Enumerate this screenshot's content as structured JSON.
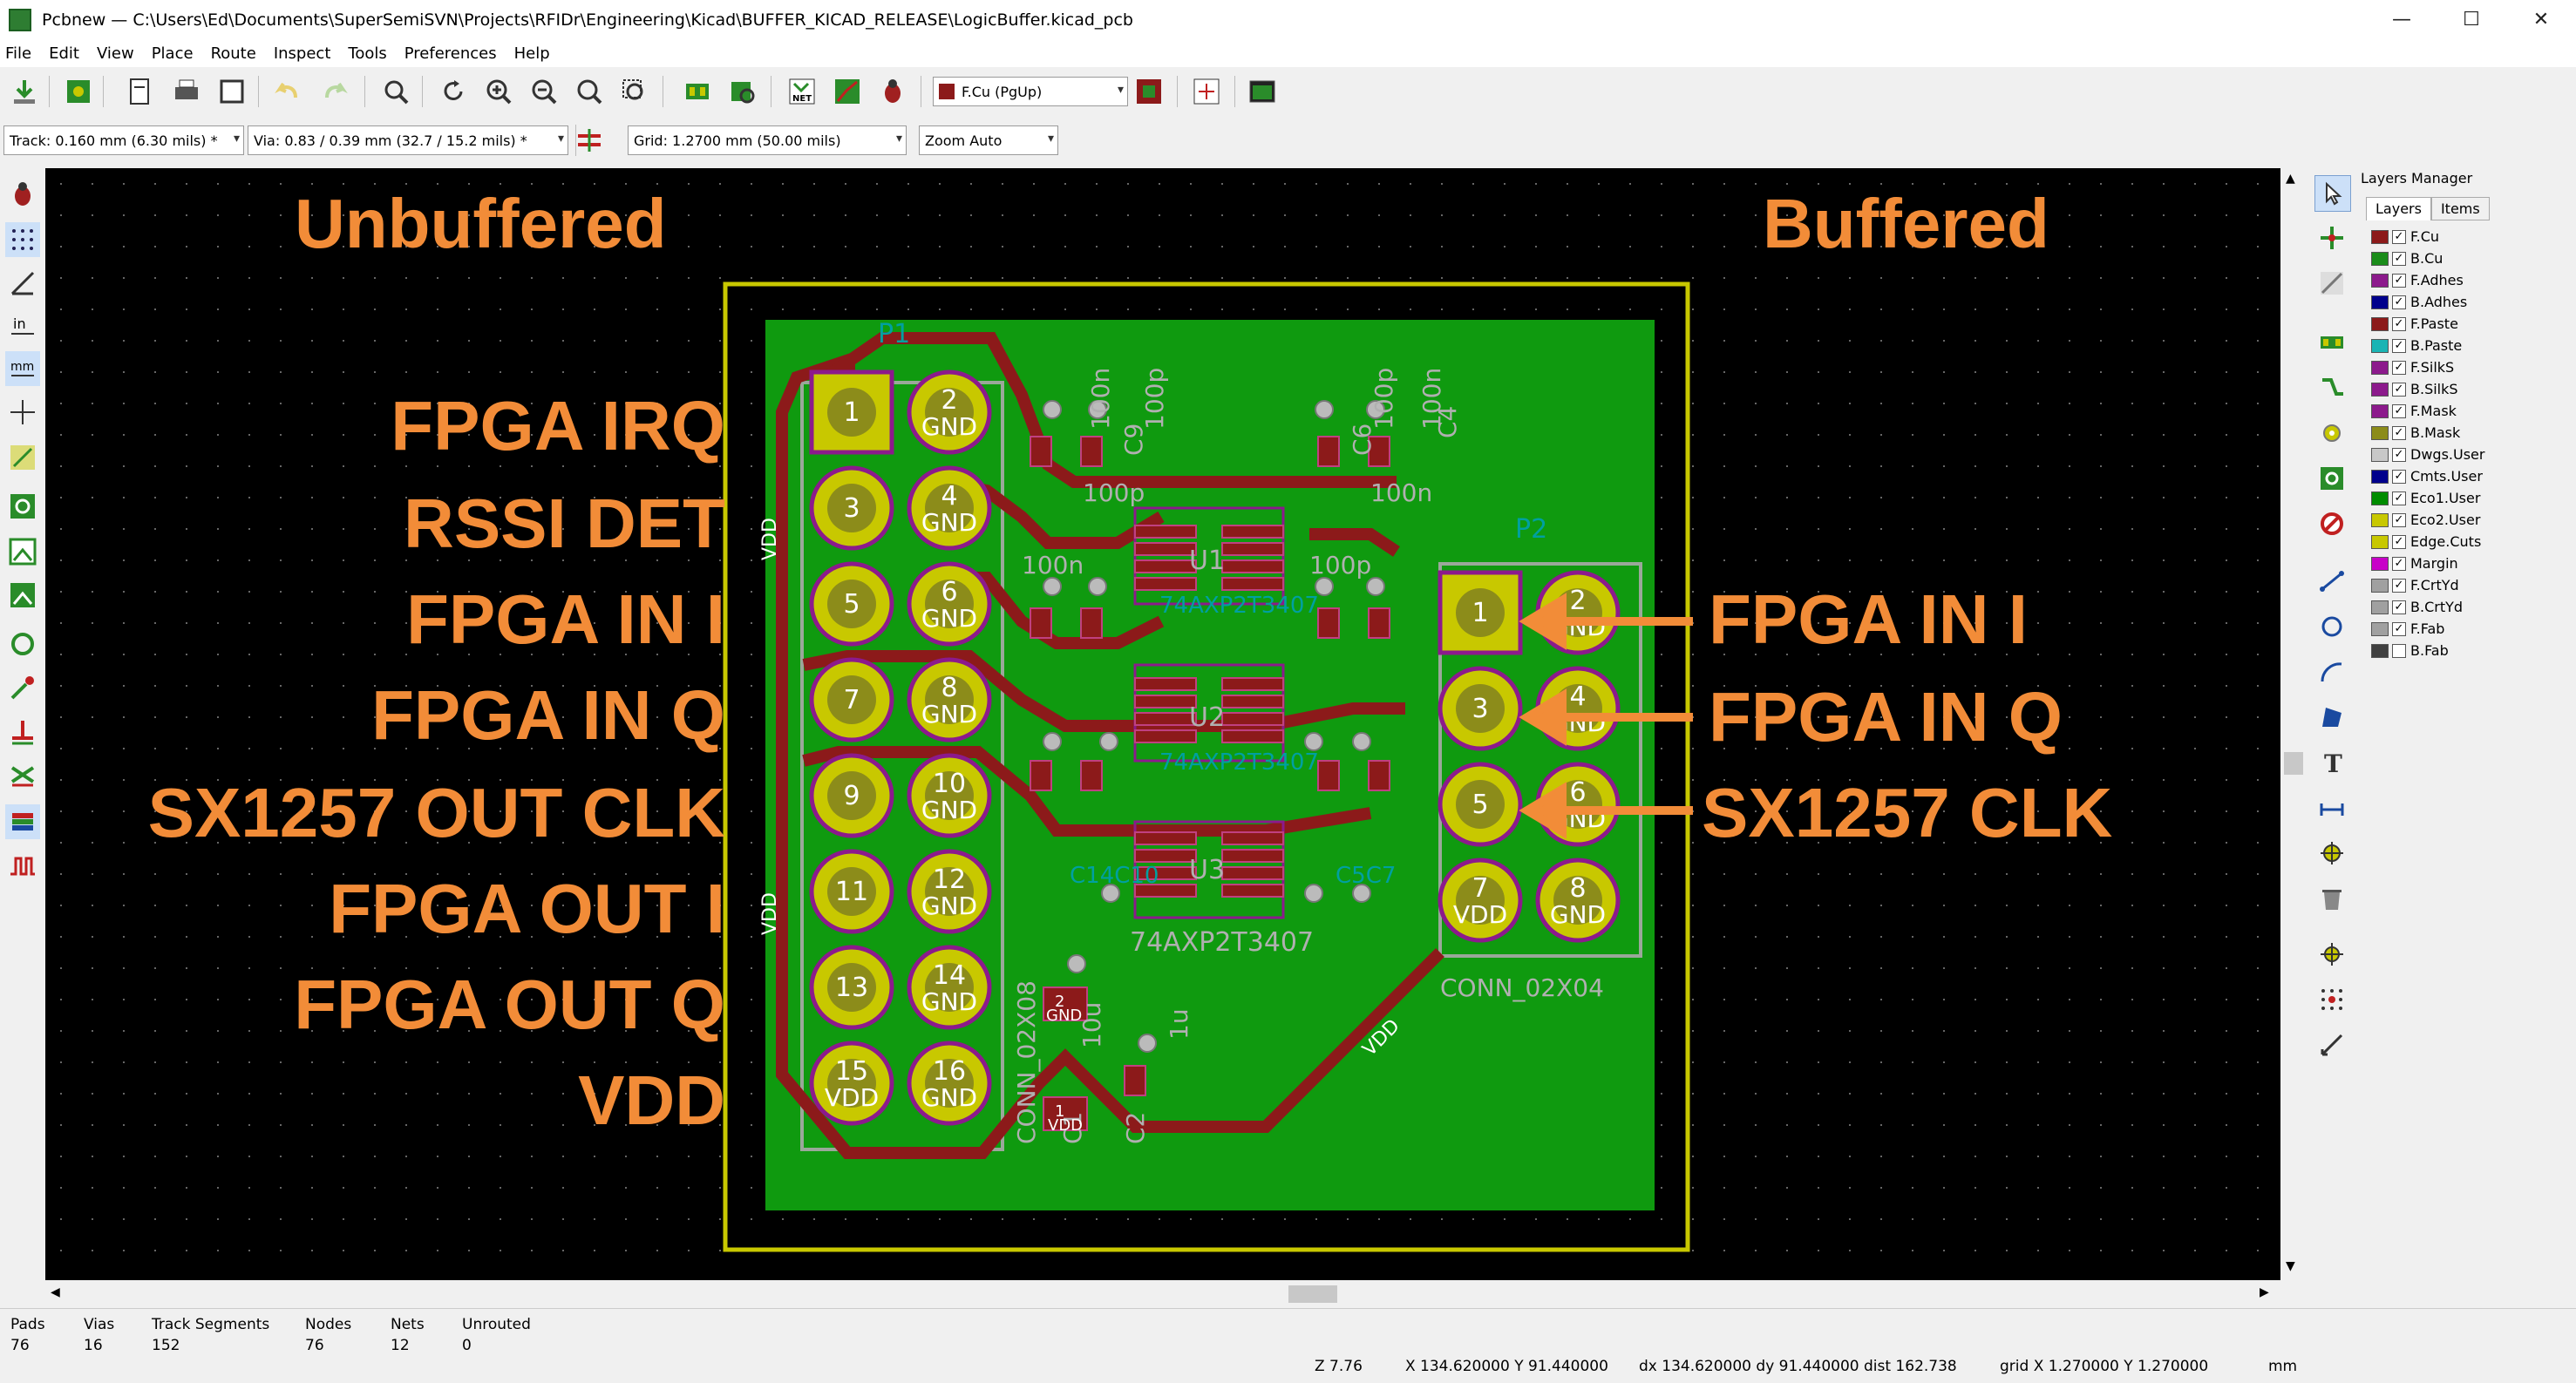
{
  "window": {
    "title": "Pcbnew — C:\\Users\\Ed\\Documents\\SuperSemiSVN\\Projects\\RFIDr\\Engineering\\Kicad\\BUFFER_KICAD_RELEASE\\LogicBuffer.kicad_pcb",
    "minimize": "—",
    "maximize": "☐",
    "close": "✕"
  },
  "menu": [
    "File",
    "Edit",
    "View",
    "Place",
    "Route",
    "Inspect",
    "Tools",
    "Preferences",
    "Help"
  ],
  "toolbar": {
    "layer_select": "F.Cu (PgUp)",
    "track": "Track: 0.160 mm (6.30 mils) *",
    "via": "Via: 0.83 / 0.39 mm (32.7 / 15.2 mils) *",
    "grid": "Grid: 1.2700 mm (50.00 mils)",
    "zoom": "Zoom Auto"
  },
  "board": {
    "left_heading": "Unbuffered",
    "right_heading": "Buffered",
    "left_labels": [
      "FPGA IRQ",
      "RSSI DET",
      "FPGA IN I",
      "FPGA IN Q",
      "SX1257 OUT CLK",
      "FPGA OUT I",
      "FPGA OUT Q",
      "VDD"
    ],
    "right_labels": [
      "FPGA IN I",
      "FPGA IN Q",
      "SX1257 CLK"
    ],
    "p1_pins": [
      {
        "num": "1",
        "net": ""
      },
      {
        "num": "2",
        "net": "GND"
      },
      {
        "num": "3",
        "net": ""
      },
      {
        "num": "4",
        "net": "GND"
      },
      {
        "num": "5",
        "net": ""
      },
      {
        "num": "6",
        "net": "GND"
      },
      {
        "num": "7",
        "net": ""
      },
      {
        "num": "8",
        "net": "GND"
      },
      {
        "num": "9",
        "net": ""
      },
      {
        "num": "10",
        "net": "GND"
      },
      {
        "num": "11",
        "net": ""
      },
      {
        "num": "12",
        "net": "GND"
      },
      {
        "num": "13",
        "net": ""
      },
      {
        "num": "14",
        "net": "GND"
      },
      {
        "num": "15",
        "net": "VDD"
      },
      {
        "num": "16",
        "net": "GND"
      }
    ],
    "p2_pins": [
      {
        "num": "1",
        "net": ""
      },
      {
        "num": "2",
        "net": "GND"
      },
      {
        "num": "3",
        "net": ""
      },
      {
        "num": "4",
        "net": "GND"
      },
      {
        "num": "5",
        "net": ""
      },
      {
        "num": "6",
        "net": "GND"
      },
      {
        "num": "7",
        "net": "VDD"
      },
      {
        "num": "8",
        "net": "GND"
      }
    ],
    "ref_p1": "P1",
    "ref_p2": "P2",
    "p1_value": "CONN_02X08",
    "p2_value": "CONN_02X04",
    "u1": "U1",
    "u2": "U2",
    "u3": "U3",
    "u_value_1": "74AXP2T3407",
    "u_value_2": "74AXP2T3407",
    "u_value_3": "74AXP2T3407",
    "cap_100n": "100n",
    "cap_100p": "100p",
    "cap_10u": "10u",
    "cap_1u": "1u",
    "vdd_net": "VDD",
    "pad_gnd": "GND",
    "pad_vdd": "VDD",
    "pad_2": "2",
    "pad_1": "1",
    "c_labels": "C14C10",
    "c_labels2": "C5C7",
    "c1": "C1",
    "c2": "C2",
    "c4": "C4",
    "c6": "C6",
    "c9": "C9"
  },
  "layers_manager": {
    "title": "Layers Manager",
    "tabs": [
      "Layers",
      "Items"
    ],
    "layers": [
      {
        "name": "F.Cu",
        "color": "#8c1a1a",
        "checked": true
      },
      {
        "name": "B.Cu",
        "color": "#1a8c1a",
        "checked": true
      },
      {
        "name": "F.Adhes",
        "color": "#8c1a8c",
        "checked": true
      },
      {
        "name": "B.Adhes",
        "color": "#00008c",
        "checked": true
      },
      {
        "name": "F.Paste",
        "color": "#8c1a1a",
        "checked": true
      },
      {
        "name": "B.Paste",
        "color": "#1ab4b4",
        "checked": true
      },
      {
        "name": "F.SilkS",
        "color": "#8c1a8c",
        "checked": true
      },
      {
        "name": "B.SilkS",
        "color": "#8c1a8c",
        "checked": true
      },
      {
        "name": "F.Mask",
        "color": "#8c1a8c",
        "checked": true
      },
      {
        "name": "B.Mask",
        "color": "#8c8c1a",
        "checked": true
      },
      {
        "name": "Dwgs.User",
        "color": "#c8c8c8",
        "checked": true
      },
      {
        "name": "Cmts.User",
        "color": "#00008c",
        "checked": true
      },
      {
        "name": "Eco1.User",
        "color": "#008c00",
        "checked": true
      },
      {
        "name": "Eco2.User",
        "color": "#c8c800",
        "checked": true
      },
      {
        "name": "Edge.Cuts",
        "color": "#c8c800",
        "checked": true
      },
      {
        "name": "Margin",
        "color": "#c800c8",
        "checked": true
      },
      {
        "name": "F.CrtYd",
        "color": "#a0a0a0",
        "checked": true
      },
      {
        "name": "B.CrtYd",
        "color": "#a0a0a0",
        "checked": true
      },
      {
        "name": "F.Fab",
        "color": "#a0a0a0",
        "checked": true
      },
      {
        "name": "B.Fab",
        "color": "#404040",
        "checked": false
      }
    ]
  },
  "status": {
    "pads_label": "Pads",
    "pads": "76",
    "vias_label": "Vias",
    "vias": "16",
    "tracks_label": "Track Segments",
    "tracks": "152",
    "nodes_label": "Nodes",
    "nodes": "76",
    "nets_label": "Nets",
    "nets": "12",
    "unrouted_label": "Unrouted",
    "unrouted": "0",
    "zoom": "Z 7.76",
    "xy": "X 134.620000  Y 91.440000",
    "dxdy": "dx 134.620000  dy 91.440000  dist 162.738",
    "grid": "grid X 1.270000  Y 1.270000",
    "units": "mm"
  },
  "colors": {
    "background": "#000000",
    "board_fill": "#0f9a0f",
    "track": "#8c1a1a",
    "pad": "#c8c800",
    "label": "#f28c38",
    "edge": "#c8c800"
  }
}
